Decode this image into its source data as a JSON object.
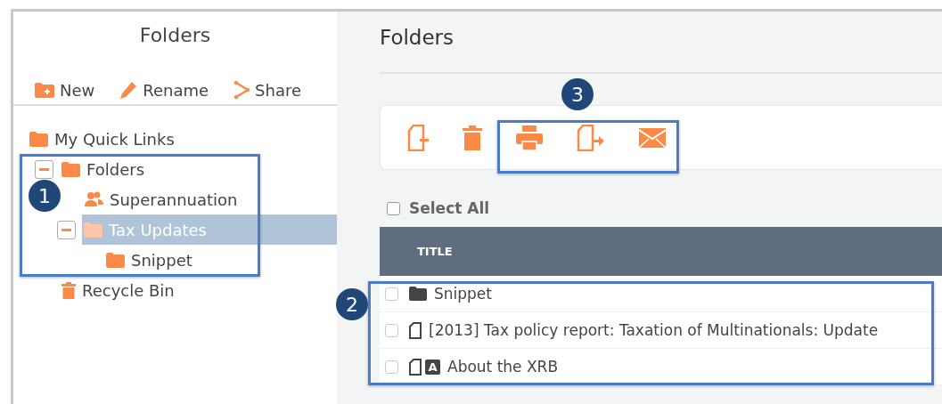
{
  "sidebar": {
    "title": "Folders",
    "actions": [
      {
        "label": "New"
      },
      {
        "label": "Rename"
      },
      {
        "label": "Share"
      }
    ],
    "tree": [
      {
        "label": "My Quick Links",
        "kind": "folder",
        "selected": false
      },
      {
        "label": "Folders",
        "kind": "folder",
        "selected": false,
        "expanded": true,
        "children": [
          {
            "label": "Superannuation",
            "kind": "group",
            "selected": false
          },
          {
            "label": "Tax Updates",
            "kind": "folder",
            "selected": true,
            "expanded": true,
            "children": [
              {
                "label": "Snippet",
                "kind": "folder",
                "selected": false
              }
            ]
          }
        ]
      },
      {
        "label": "Recycle Bin",
        "kind": "bin",
        "selected": false
      }
    ]
  },
  "main": {
    "title": "Folders",
    "select_all": {
      "label": "Select All",
      "checked": false
    },
    "table": {
      "columns": [
        "TITLE"
      ],
      "rows": [
        {
          "title": "Snippet",
          "kind": "folder",
          "checked": false
        },
        {
          "title": "[2013] Tax policy report: Taxation of Multinationals: Update",
          "kind": "document",
          "checked": false
        },
        {
          "title": "About the XRB",
          "kind": "document",
          "badge": "A",
          "checked": false
        }
      ]
    }
  },
  "callouts": [
    {
      "number": "1"
    },
    {
      "number": "2"
    },
    {
      "number": "3"
    }
  ]
}
